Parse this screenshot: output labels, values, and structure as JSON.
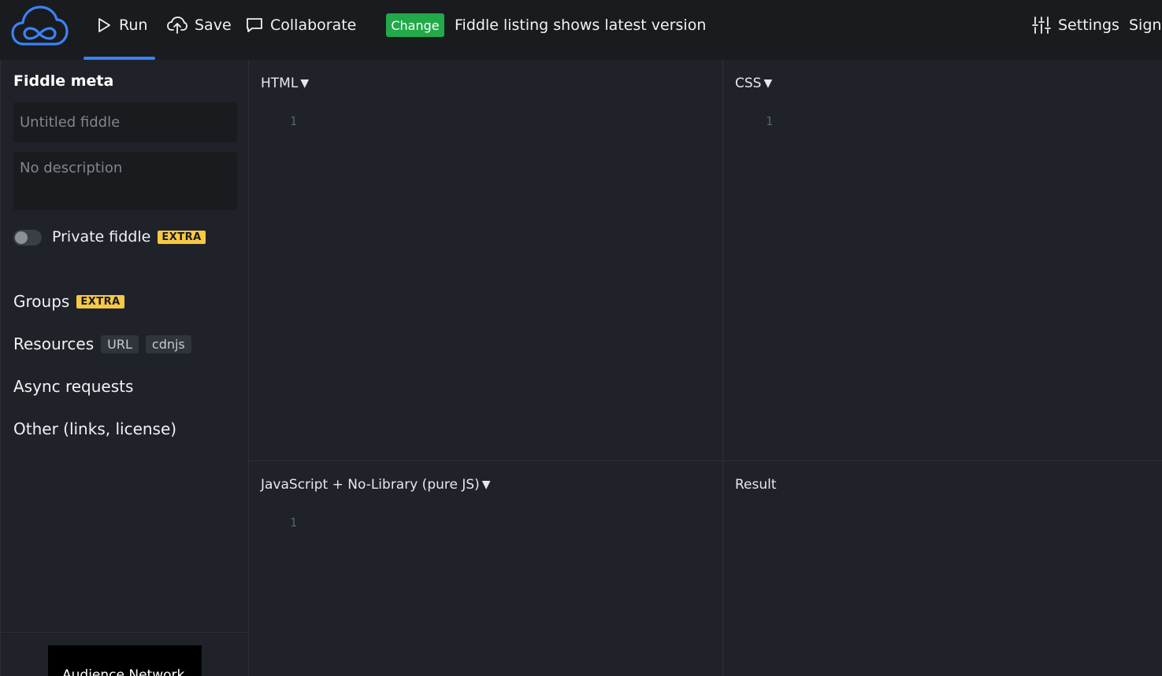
{
  "header": {
    "logo_icon": "cloud-infinity-logo",
    "run_label": "Run",
    "save_label": "Save",
    "collaborate_label": "Collaborate",
    "change_badge": "Change",
    "announcement": "Fiddle listing shows latest version",
    "settings_label": "Settings",
    "sign_label": "Sign",
    "active_tab": "Run"
  },
  "sidebar": {
    "title": "Fiddle meta",
    "title_placeholder": "Untitled fiddle",
    "description_placeholder": "No description",
    "private_label": "Private fiddle",
    "private_badge": "EXTRA",
    "private_enabled": false,
    "groups_label": "Groups",
    "groups_badge": "EXTRA",
    "resources_label": "Resources",
    "resources_tags": [
      "URL",
      "cdnjs"
    ],
    "async_label": "Async requests",
    "other_label": "Other (links, license)",
    "ad_text": "Audience Network"
  },
  "panels": {
    "html": {
      "label": "HTML",
      "line": "1"
    },
    "css": {
      "label": "CSS",
      "line": "1"
    },
    "js": {
      "label": "JavaScript + No-Library (pure JS)",
      "line": "1"
    },
    "result": {
      "label": "Result"
    }
  },
  "colors": {
    "background": "#1f2228",
    "topbar": "#191b1f",
    "accent": "#3b82f6",
    "change_green": "#22a94a",
    "extra_yellow": "#f6c945"
  }
}
